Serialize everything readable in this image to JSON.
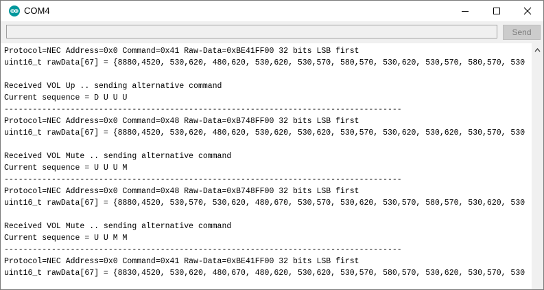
{
  "window": {
    "title": "COM4"
  },
  "toolbar": {
    "input_value": "",
    "send_label": "Send"
  },
  "output": {
    "lines": [
      "Protocol=NEC Address=0x0 Command=0x41 Raw-Data=0xBE41FF00 32 bits LSB first",
      "uint16_t rawData[67] = {8880,4520, 530,620, 480,620, 530,620, 530,570, 580,570, 530,620, 530,570, 580,570, 530",
      "",
      "Received VOL Up .. sending alternative command",
      "Current sequence = D U U U",
      "------------------------------------------------------------------------------------",
      "Protocol=NEC Address=0x0 Command=0x48 Raw-Data=0xB748FF00 32 bits LSB first",
      "uint16_t rawData[67] = {8880,4520, 530,620, 480,620, 530,620, 530,620, 530,570, 530,620, 530,620, 530,570, 530",
      "",
      "Received VOL Mute .. sending alternative command",
      "Current sequence = U U U M",
      "------------------------------------------------------------------------------------",
      "Protocol=NEC Address=0x0 Command=0x48 Raw-Data=0xB748FF00 32 bits LSB first",
      "uint16_t rawData[67] = {8880,4520, 530,570, 530,620, 480,670, 530,570, 530,620, 530,570, 580,570, 530,620, 530",
      "",
      "Received VOL Mute .. sending alternative command",
      "Current sequence = U U M M",
      "------------------------------------------------------------------------------------",
      "Protocol=NEC Address=0x0 Command=0x41 Raw-Data=0xBE41FF00 32 bits LSB first",
      "uint16_t rawData[67] = {8830,4520, 530,620, 480,670, 480,620, 530,620, 530,570, 580,570, 530,620, 530,570, 530"
    ]
  },
  "colors": {
    "accent": "#00979c",
    "send_bg": "#cccccc",
    "send_text": "#7a7a7a",
    "panel": "#f0f0f0"
  },
  "icons": {
    "app": "arduino-logo-icon",
    "minimize": "minimize-icon",
    "maximize": "maximize-icon",
    "close": "close-icon",
    "scroll_up": "chevron-up-icon"
  }
}
